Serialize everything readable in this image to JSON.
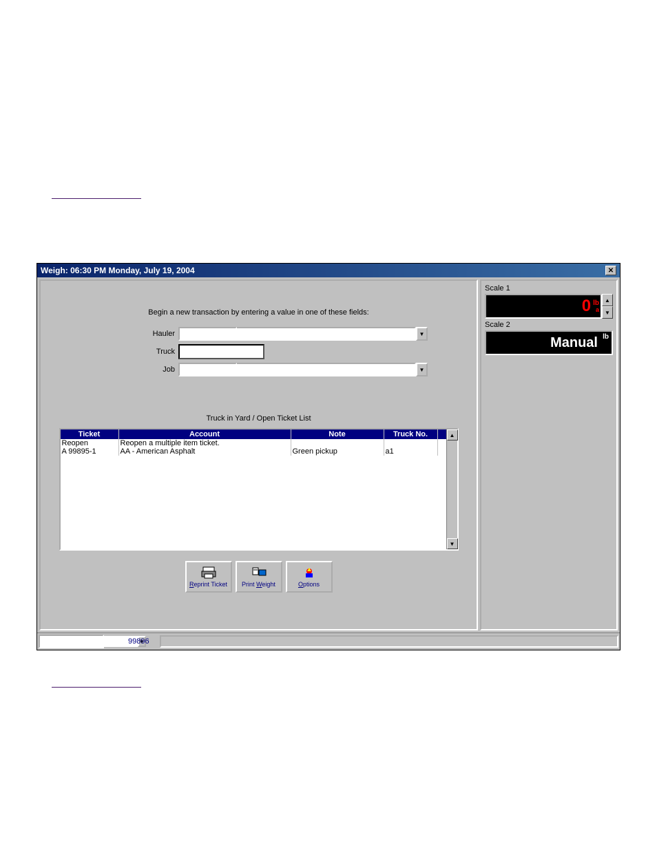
{
  "sections": {
    "top_label": "",
    "bottom_label": ""
  },
  "title_bar": {
    "text": "Weigh:   06:30 PM   Monday, July 19, 2004"
  },
  "instruction": "Begin a new transaction by entering a value in one of these fields:",
  "fields": {
    "hauler_label": "Hauler",
    "truck_label": "Truck",
    "job_label": "Job",
    "hauler_value": "",
    "hauler_desc": "",
    "truck_value": "",
    "job_value": "",
    "job_desc": ""
  },
  "list": {
    "title": "Truck in Yard / Open Ticket List",
    "columns": {
      "ticket": "Ticket",
      "account": "Account",
      "note": "Note",
      "truckno": "Truck No."
    },
    "rows": [
      {
        "ticket": "Reopen",
        "account": "Reopen a multiple item ticket.",
        "note": "",
        "truckno": ""
      },
      {
        "ticket": "A 99895-1",
        "account": "AA - American Asphalt",
        "note": "Green pickup",
        "truckno": "a1"
      }
    ]
  },
  "buttons": {
    "reprint_prefix": "R",
    "reprint_suffix": "eprint Ticket",
    "print_prefix": "Print ",
    "print_underline": "W",
    "print_suffix": "eight",
    "options_underline": "O",
    "options_suffix": "ptions"
  },
  "scales": {
    "scale1_label": "Scale 1",
    "scale1_value": "0",
    "scale1_unit": "lb",
    "scale1_a": "a",
    "scale2_label": "Scale 2",
    "scale2_value": "Manual",
    "scale2_unit": "lb"
  },
  "status": {
    "number": "99896"
  }
}
